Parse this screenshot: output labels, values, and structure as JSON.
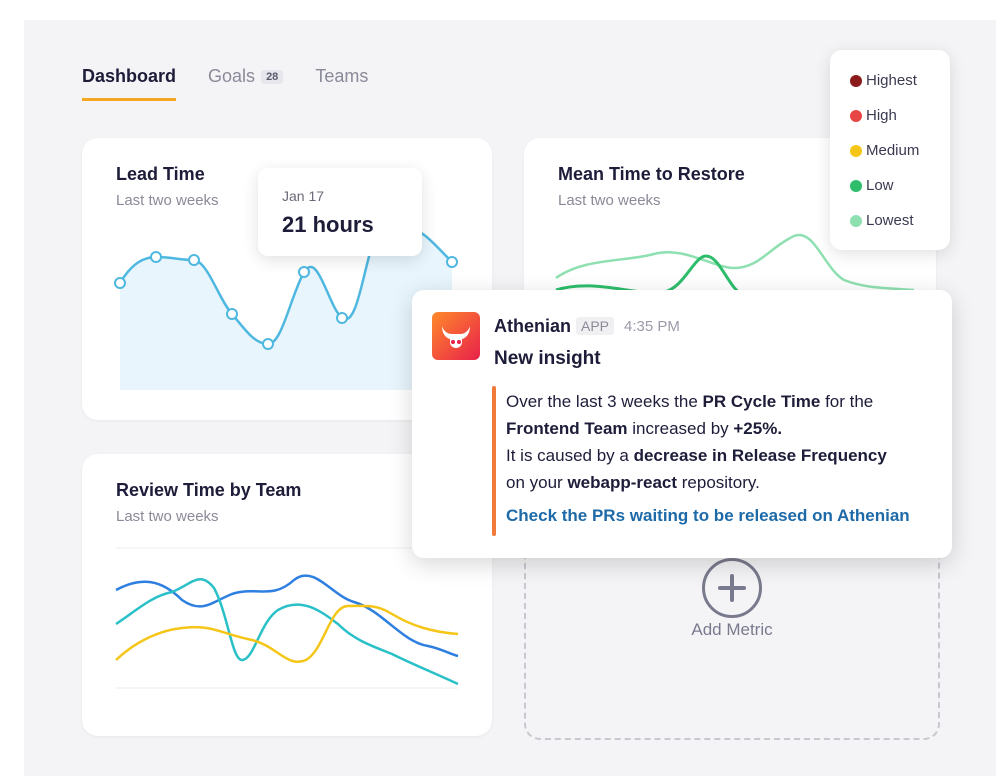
{
  "tabs": [
    {
      "label": "Dashboard",
      "active": true
    },
    {
      "label": "Goals",
      "badge": "28"
    },
    {
      "label": "Teams"
    }
  ],
  "lead_time": {
    "title": "Lead Time",
    "subtitle": "Last two weeks",
    "tooltip": {
      "date": "Jan 17",
      "value": "21 hours"
    }
  },
  "mttr": {
    "title": "Mean Time to Restore",
    "subtitle": "Last two weeks"
  },
  "review": {
    "title": "Review Time by Team",
    "subtitle": "Last two weeks"
  },
  "add_metric": {
    "label": "Add Metric"
  },
  "legend": [
    {
      "label": "Highest",
      "color": "#8b1a1a"
    },
    {
      "label": "High",
      "color": "#e84545"
    },
    {
      "label": "Medium",
      "color": "#f5c518"
    },
    {
      "label": "Low",
      "color": "#2ebd6b"
    },
    {
      "label": "Lowest",
      "color": "#8fe0b0"
    }
  ],
  "notification": {
    "app": "Athenian",
    "badge": "APP",
    "time": "4:35 PM",
    "title": "New insight",
    "line1_a": "Over the last 3 weeks the ",
    "line1_b": "PR Cycle Time",
    "line1_c": " for the",
    "line2_a": "Frontend Team",
    "line2_b": " increased by ",
    "line2_c": "+25%.",
    "line3_a": "It is caused by a ",
    "line3_b": "decrease in Release Frequency",
    "line4_a": "on your ",
    "line4_b": "webapp-react",
    "line4_c": " repository.",
    "link": "Check the PRs waiting to be released on Athenian"
  },
  "colors": {
    "accent": "#f5a623",
    "lead_line": "#4fb8e0",
    "lead_fill": "#e8f5fc",
    "review_blue": "#2d7fe0",
    "review_teal": "#2ac0c8",
    "review_yellow": "#f5c518",
    "link": "#1e6aa8"
  }
}
